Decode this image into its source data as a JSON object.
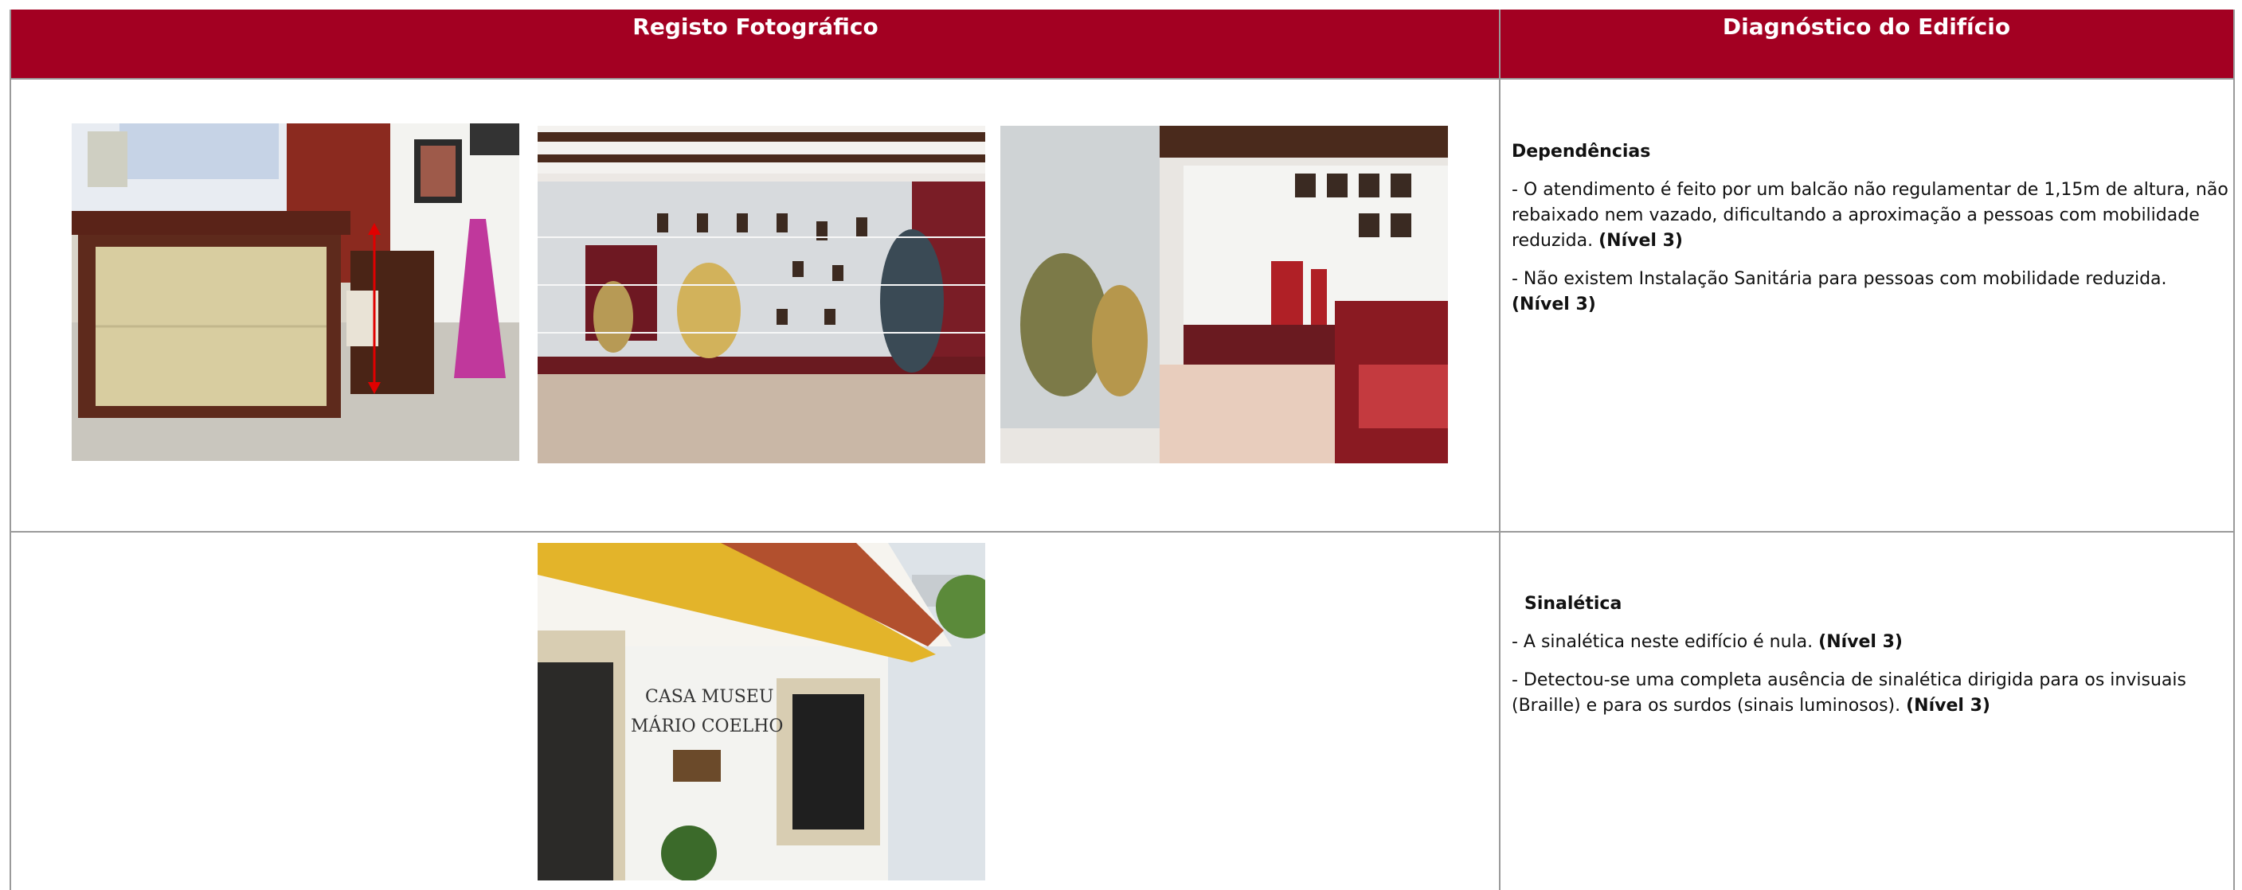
{
  "header": {
    "left_title": "Registo Fotográfico",
    "right_title": "Diagnóstico do Edifício"
  },
  "row1": {
    "heading": "Dependências",
    "items": [
      {
        "text": "- O atendimento é feito por um balcão não regulamentar de 1,15m de altura, não rebaixado nem vazado, dificultando a aproximação a pessoas com mobilidade reduzida. ",
        "level": "(Nível 3)"
      },
      {
        "text": "- Não existem Instalação Sanitária para pessoas com mobilidade reduzida. ",
        "level": "(Nível 3)"
      }
    ]
  },
  "row2": {
    "heading": "Sinalética",
    "items": [
      {
        "text": "- A sinalética neste edifício é nula.  ",
        "level": "(Nível 3)"
      },
      {
        "text": "- Detectou-se uma completa ausência de sinalética dirigida para os invisuais (Braille) e para os surdos (sinais luminosos). ",
        "level": "(Nível 3)"
      }
    ]
  },
  "photo_sign": {
    "line1": "CASA MUSEU",
    "line2": "MÁRIO COELHO"
  },
  "colors": {
    "header_bg": "#a30022",
    "header_text": "#ffffff",
    "border": "#9a9a9a"
  }
}
